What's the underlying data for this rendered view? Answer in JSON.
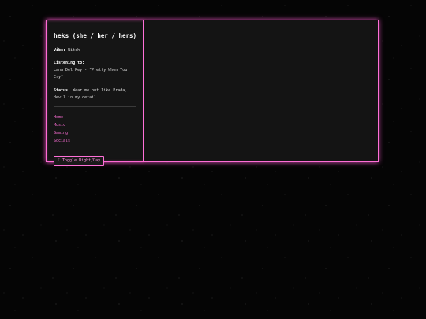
{
  "profile": {
    "name": "heks",
    "pronouns": "(she / her / hers)",
    "vibe_label": "Vibe:",
    "vibe_value": "Witch",
    "listening_label": "Listening to:",
    "listening_value": "Lana Del Rey - \"Pretty When You Cry\"",
    "status_label": "Status:",
    "status_value": "Wear me out like Prada, devil in my detail"
  },
  "nav": {
    "items": [
      "Home",
      "Music",
      "Gaming",
      "Socials"
    ]
  },
  "toggle": {
    "icon": "moon-icon",
    "glyph": "☾",
    "label": "Toggle Night/Day"
  },
  "colors": {
    "accent": "#ff6fd8",
    "panel": "#151515",
    "background": "#050505"
  }
}
